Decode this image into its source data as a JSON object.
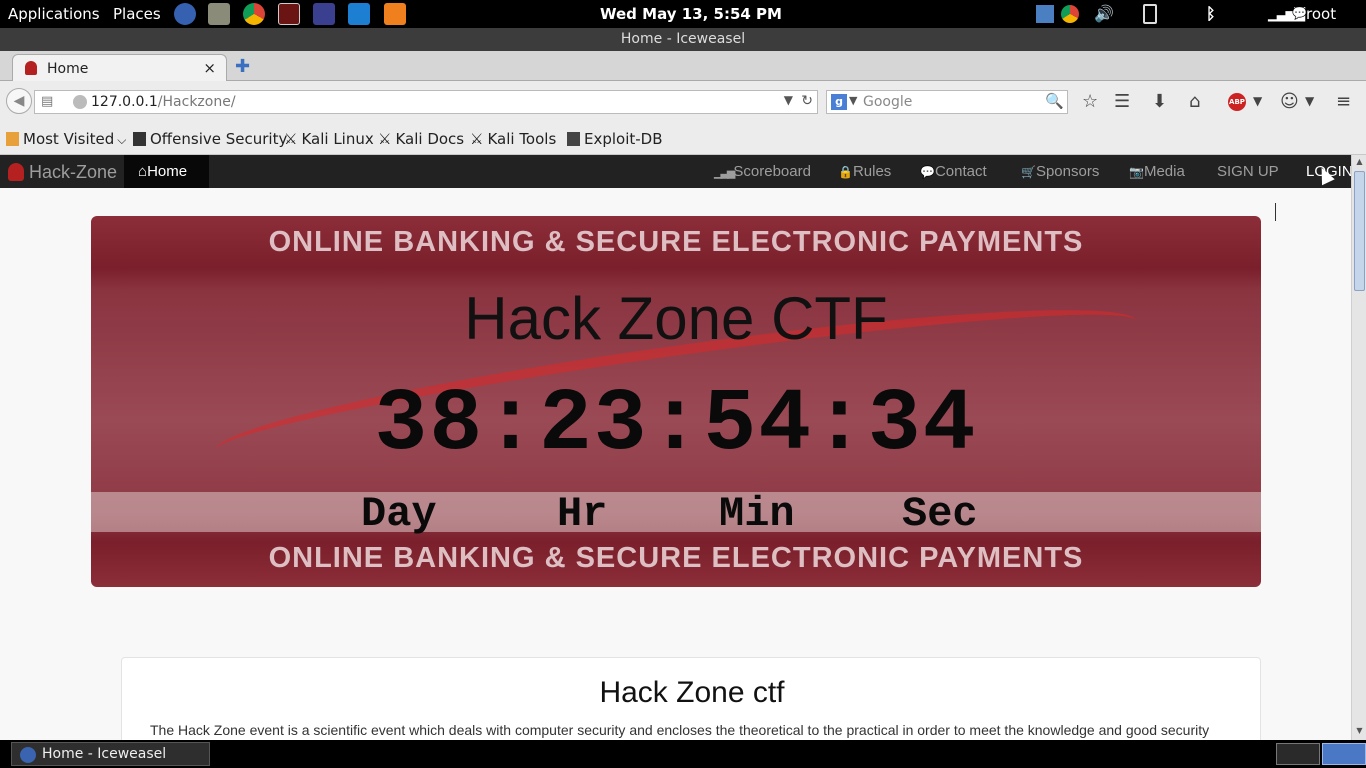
{
  "panel": {
    "applications": "Applications",
    "places": "Places",
    "clock": "Wed May 13,  5:54 PM",
    "user": "root",
    "launchers": [
      "iceweasel-icon",
      "files-icon",
      "chrome-icon",
      "terminal-icon",
      "eclipse-icon",
      "intellij-icon",
      "xampp-icon"
    ]
  },
  "window": {
    "title": "Home - Iceweasel"
  },
  "tabs": [
    {
      "label": "Home",
      "close": "×"
    }
  ],
  "newtab": "✚",
  "navbar": {
    "url_host": "127.0.0.1",
    "url_path": "/Hackzone/",
    "search_placeholder": "Google",
    "search_engine_letter": "g"
  },
  "bookmarks": [
    {
      "label": "Most Visited",
      "dropdown": "⌵"
    },
    {
      "label": "Offensive Security"
    },
    {
      "label": "Kali Linux"
    },
    {
      "label": "Kali Docs"
    },
    {
      "label": "Kali Tools"
    },
    {
      "label": "Exploit-DB"
    }
  ],
  "site": {
    "brand": "Hack-Zone",
    "nav": {
      "home": "Home",
      "scoreboard": "Scoreboard",
      "rules": "Rules",
      "contact": "Contact",
      "sponsors": "Sponsors",
      "media": "Media",
      "signup": "SIGN UP",
      "login": "LOGIN"
    },
    "hero": {
      "banner_text": "ONLINE BANKING & SECURE ELECTRONIC PAYMENTS",
      "title": "Hack Zone CTF",
      "countdown": "38:23:54:34",
      "units": {
        "day": "Day",
        "hour": "Hr",
        "min": "Min",
        "sec": "Sec"
      }
    },
    "about": {
      "title": "Hack Zone ctf",
      "text": "The Hack Zone event is a scientific event which deals with computer security and encloses the theoretical to the practical in order to meet the knowledge and good security"
    }
  },
  "taskbar": {
    "item": "Home - Iceweasel",
    "workspace_1": "",
    "workspace_2": ""
  }
}
